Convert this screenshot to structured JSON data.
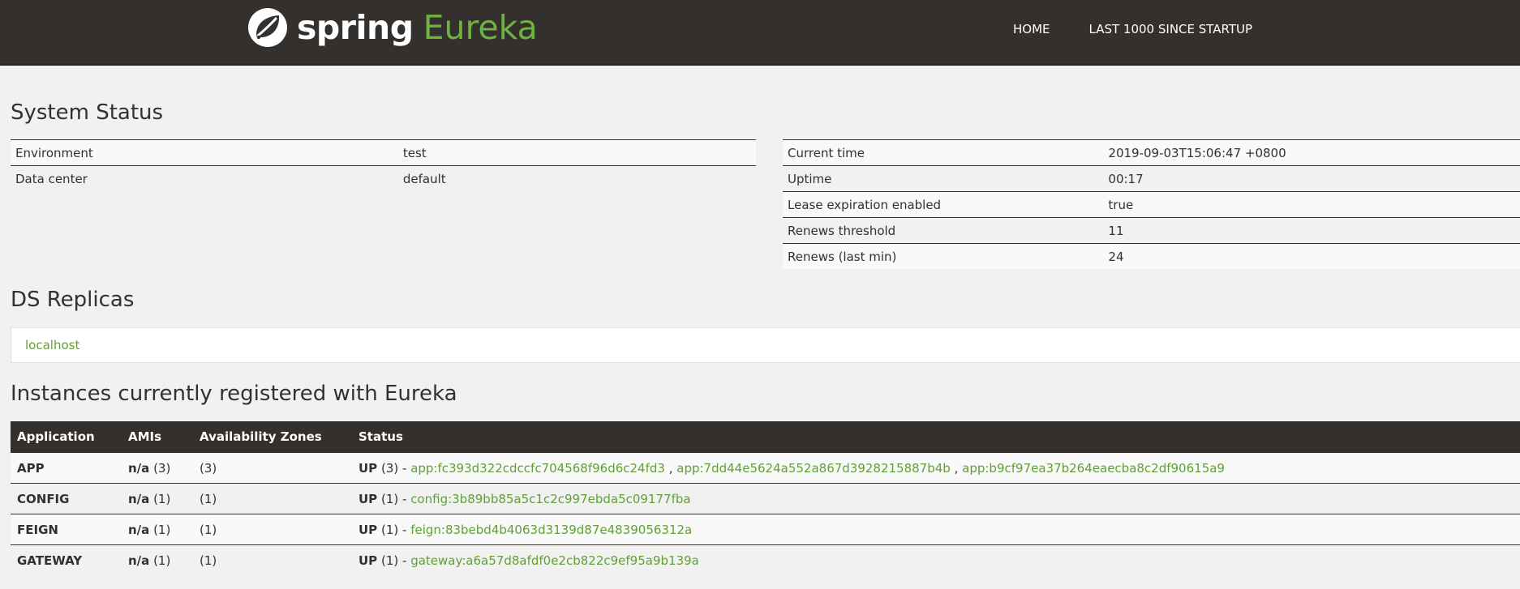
{
  "brand": {
    "spring": "spring",
    "eureka": "Eureka"
  },
  "nav": {
    "home": "HOME",
    "last1000": "LAST 1000 SINCE STARTUP"
  },
  "system_status": {
    "heading": "System Status",
    "left": [
      {
        "label": "Environment",
        "value": "test"
      },
      {
        "label": "Data center",
        "value": "default"
      }
    ],
    "right": [
      {
        "label": "Current time",
        "value": "2019-09-03T15:06:47 +0800"
      },
      {
        "label": "Uptime",
        "value": "00:17"
      },
      {
        "label": "Lease expiration enabled",
        "value": "true"
      },
      {
        "label": "Renews threshold",
        "value": "11"
      },
      {
        "label": "Renews (last min)",
        "value": "24"
      }
    ]
  },
  "ds_replicas": {
    "heading": "DS Replicas",
    "items": [
      "localhost"
    ]
  },
  "instances": {
    "heading": "Instances currently registered with Eureka",
    "columns": [
      "Application",
      "AMIs",
      "Availability Zones",
      "Status"
    ],
    "rows": [
      {
        "app": "APP",
        "ami_label": "n/a",
        "ami_count": "(3)",
        "zones": "(3)",
        "status": "UP",
        "status_count": "(3) -",
        "instances": [
          "app:fc393d322cdccfc704568f96d6c24fd3",
          "app:7dd44e5624a552a867d3928215887b4b",
          "app:b9cf97ea37b264eaecba8c2df90615a9"
        ]
      },
      {
        "app": "CONFIG",
        "ami_label": "n/a",
        "ami_count": "(1)",
        "zones": "(1)",
        "status": "UP",
        "status_count": "(1) -",
        "instances": [
          "config:3b89bb85a5c1c2c997ebda5c09177fba"
        ]
      },
      {
        "app": "FEIGN",
        "ami_label": "n/a",
        "ami_count": "(1)",
        "zones": "(1)",
        "status": "UP",
        "status_count": "(1) -",
        "instances": [
          "feign:83bebd4b4063d3139d87e4839056312a"
        ]
      },
      {
        "app": "GATEWAY",
        "ami_label": "n/a",
        "ami_count": "(1)",
        "zones": "(1)",
        "status": "UP",
        "status_count": "(1) -",
        "instances": [
          "gateway:a6a57d8afdf0e2cb822c9ef95a9b139a"
        ]
      }
    ]
  },
  "colors": {
    "navbar": "#34302d",
    "accent": "#6db33f",
    "link": "#5fa134",
    "background": "#f1f1f1"
  },
  "icons": {
    "logo": "spring-leaf-icon"
  }
}
